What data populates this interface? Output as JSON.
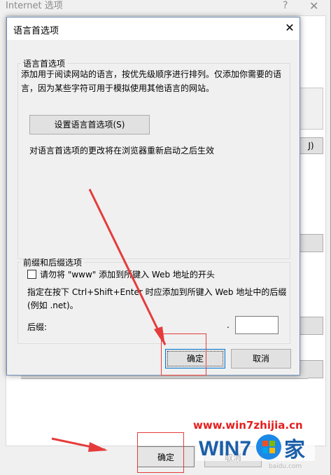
{
  "background_window": {
    "title": "Internet 选项",
    "help_glyph": "?",
    "close_glyph": "✕",
    "fragment_label": "J)",
    "ok_label": "确定",
    "cancel_label": "取消"
  },
  "dialog": {
    "title": "语言首选项",
    "close_glyph": "✕",
    "language_group": {
      "legend": "语言首选项",
      "description": "添加用于阅读网站的语言，按优先级顺序进行排列。仅添加你需要的语言，因为某些字符可用于模拟使用其他语言的网站。",
      "set_button_label": "设置语言首选项(S)",
      "note": "对语言首选项的更改将在浏览器重新启动之后生效"
    },
    "prefix_group": {
      "legend": "前缀和后缀选项",
      "checkbox_label": "请勿将 \"www\" 添加到所键入 Web 地址的开头",
      "checkbox_checked": false,
      "suffix_description": "指定在按下 Ctrl+Shift+Enter 时应添加到所键入 Web 地址中的后缀(例如 .net)。",
      "suffix_label": "后缀:",
      "dot": ".",
      "suffix_value": ""
    },
    "ok_label": "确定",
    "cancel_label": "取消"
  },
  "annotations": {
    "highlight_color": "#e53b3b"
  },
  "watermark": {
    "url": "www.win7zhijia.cn",
    "logo_text_win": "WIN7",
    "logo_text_home": "家",
    "sub_text": "baidu.com"
  }
}
